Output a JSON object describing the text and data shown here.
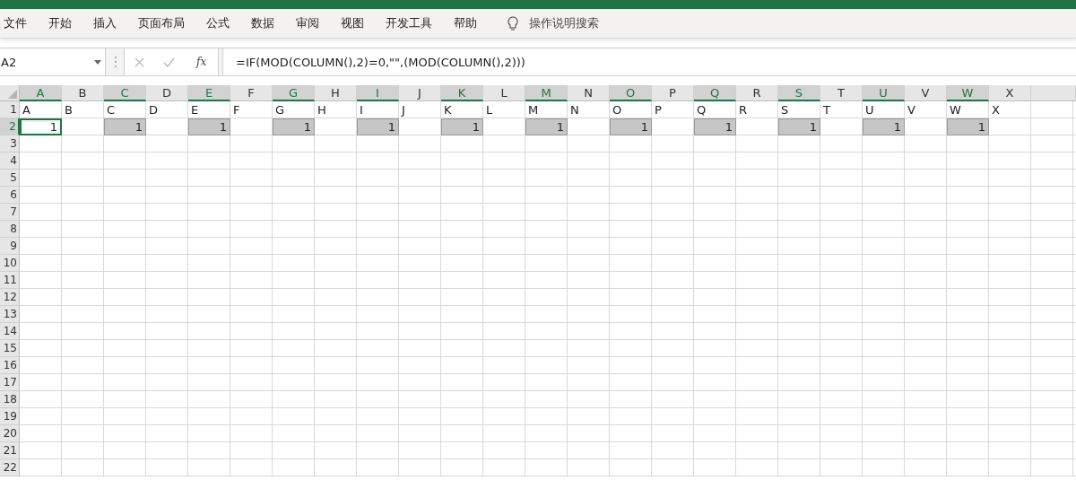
{
  "ribbon": {
    "tabs": [
      {
        "label": "文件",
        "selected": false
      },
      {
        "label": "开始",
        "selected": false
      },
      {
        "label": "插入",
        "selected": false
      },
      {
        "label": "页面布局",
        "selected": false
      },
      {
        "label": "公式",
        "selected": false
      },
      {
        "label": "数据",
        "selected": false
      },
      {
        "label": "审阅",
        "selected": false
      },
      {
        "label": "视图",
        "selected": false
      },
      {
        "label": "开发工具",
        "selected": false
      },
      {
        "label": "帮助",
        "selected": false
      }
    ],
    "search": {
      "label": "操作说明搜索"
    }
  },
  "formula_bar": {
    "name_box": "A2",
    "function_button": "fx",
    "formula": "=IF(MOD(COLUMN(),2)=0,\"\",(MOD(COLUMN(),2)))"
  },
  "sheet": {
    "columns": [
      {
        "label": "A",
        "selected": true
      },
      {
        "label": "B",
        "selected": false
      },
      {
        "label": "C",
        "selected": true
      },
      {
        "label": "D",
        "selected": false
      },
      {
        "label": "E",
        "selected": true
      },
      {
        "label": "F",
        "selected": false
      },
      {
        "label": "G",
        "selected": true
      },
      {
        "label": "H",
        "selected": false
      },
      {
        "label": "I",
        "selected": true
      },
      {
        "label": "J",
        "selected": false
      },
      {
        "label": "K",
        "selected": true
      },
      {
        "label": "L",
        "selected": false
      },
      {
        "label": "M",
        "selected": true
      },
      {
        "label": "N",
        "selected": false
      },
      {
        "label": "O",
        "selected": true
      },
      {
        "label": "P",
        "selected": false
      },
      {
        "label": "Q",
        "selected": true
      },
      {
        "label": "R",
        "selected": false
      },
      {
        "label": "S",
        "selected": true
      },
      {
        "label": "T",
        "selected": false
      },
      {
        "label": "U",
        "selected": true
      },
      {
        "label": "V",
        "selected": false
      },
      {
        "label": "W",
        "selected": true
      },
      {
        "label": "X",
        "selected": false
      }
    ],
    "rows": [
      {
        "header": "1",
        "selected": false,
        "cells": [
          {
            "value": "A"
          },
          {
            "value": "B"
          },
          {
            "value": "C"
          },
          {
            "value": "D"
          },
          {
            "value": "E"
          },
          {
            "value": "F"
          },
          {
            "value": "G"
          },
          {
            "value": "H"
          },
          {
            "value": "I"
          },
          {
            "value": "J"
          },
          {
            "value": "K"
          },
          {
            "value": "L"
          },
          {
            "value": "M"
          },
          {
            "value": "N"
          },
          {
            "value": "O"
          },
          {
            "value": "P"
          },
          {
            "value": "Q"
          },
          {
            "value": "R"
          },
          {
            "value": "S"
          },
          {
            "value": "T"
          },
          {
            "value": "U"
          },
          {
            "value": "V"
          },
          {
            "value": "W"
          },
          {
            "value": "X"
          }
        ]
      },
      {
        "header": "2",
        "selected": true,
        "cells": [
          {
            "value": "1",
            "selected": true,
            "active": true
          },
          null,
          {
            "value": "1",
            "selected": true,
            "active": false
          },
          null,
          {
            "value": "1",
            "selected": true,
            "active": false
          },
          null,
          {
            "value": "1",
            "selected": true,
            "active": false
          },
          null,
          {
            "value": "1",
            "selected": true,
            "active": false
          },
          null,
          {
            "value": "1",
            "selected": true,
            "active": false
          },
          null,
          {
            "value": "1",
            "selected": true,
            "active": false
          },
          null,
          {
            "value": "1",
            "selected": true,
            "active": false
          },
          null,
          {
            "value": "1",
            "selected": true,
            "active": false
          },
          null,
          {
            "value": "1",
            "selected": true,
            "active": false
          },
          null,
          {
            "value": "1",
            "selected": true,
            "active": false
          },
          null,
          {
            "value": "1",
            "selected": true,
            "active": false
          },
          null
        ]
      },
      {
        "header": "3",
        "selected": false
      },
      {
        "header": "4",
        "selected": false
      },
      {
        "header": "5",
        "selected": false
      },
      {
        "header": "6",
        "selected": false
      },
      {
        "header": "7",
        "selected": false
      },
      {
        "header": "8",
        "selected": false
      },
      {
        "header": "9",
        "selected": false
      },
      {
        "header": "10",
        "selected": false
      },
      {
        "header": "11",
        "selected": false
      },
      {
        "header": "12",
        "selected": false
      },
      {
        "header": "13",
        "selected": false
      },
      {
        "header": "14",
        "selected": false
      },
      {
        "header": "15",
        "selected": false
      },
      {
        "header": "16",
        "selected": false
      },
      {
        "header": "17",
        "selected": false
      },
      {
        "header": "18",
        "selected": false
      },
      {
        "header": "19",
        "selected": false
      },
      {
        "header": "20",
        "selected": false
      },
      {
        "header": "21",
        "selected": false
      },
      {
        "header": "22",
        "selected": false
      }
    ]
  }
}
